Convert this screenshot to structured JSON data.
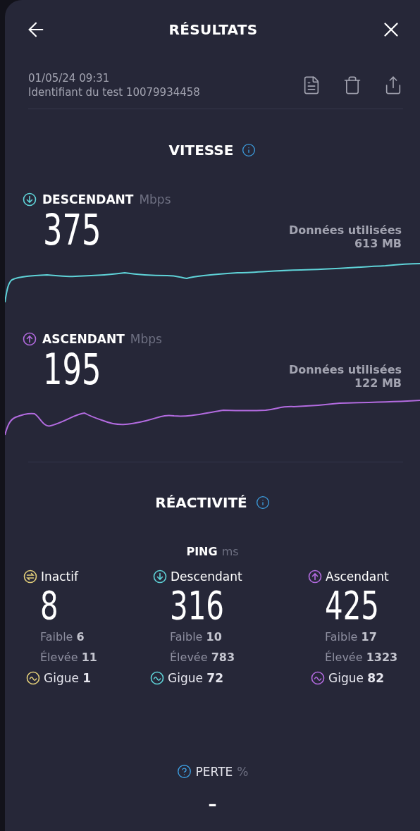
{
  "header": {
    "title": "RÉSULTATS"
  },
  "meta": {
    "datetime": "01/05/24 09:31",
    "test_id": "Identifiant du test 10079934458"
  },
  "speed": {
    "title": "VITESSE",
    "sections": [
      {
        "kind": "download",
        "label": "DESCENDANT",
        "unit": "Mbps",
        "value": "375",
        "data_label": "Données utilisées",
        "data_value": "613 MB",
        "color": "#5fd3d8"
      },
      {
        "kind": "upload",
        "label": "ASCENDANT",
        "unit": "Mbps",
        "value": "195",
        "data_label": "Données utilisées",
        "data_value": "122 MB",
        "color": "#b36be0"
      }
    ]
  },
  "responsiveness": {
    "title": "RÉACTIVITÉ",
    "ping": {
      "label": "PING",
      "unit": "ms",
      "columns": [
        {
          "kind": "idle",
          "label": "Inactif",
          "value": "8",
          "low": "Faible **6**",
          "high": "Élevée **11**",
          "jitter": "Gigue **1**",
          "color": "#e3cf7a"
        },
        {
          "kind": "download",
          "label": "Descendant",
          "value": "316",
          "low": "Faible **10**",
          "high": "Élevée **783**",
          "jitter": "Gigue **72**",
          "color": "#5fd3d8"
        },
        {
          "kind": "upload",
          "label": "Ascendant",
          "value": "425",
          "low": "Faible **17**",
          "high": "Élevée **1323**",
          "jitter": "Gigue **82**",
          "color": "#b36be0"
        }
      ]
    }
  },
  "loss": {
    "label": "PERTE",
    "unit": "%",
    "value": "–"
  }
}
